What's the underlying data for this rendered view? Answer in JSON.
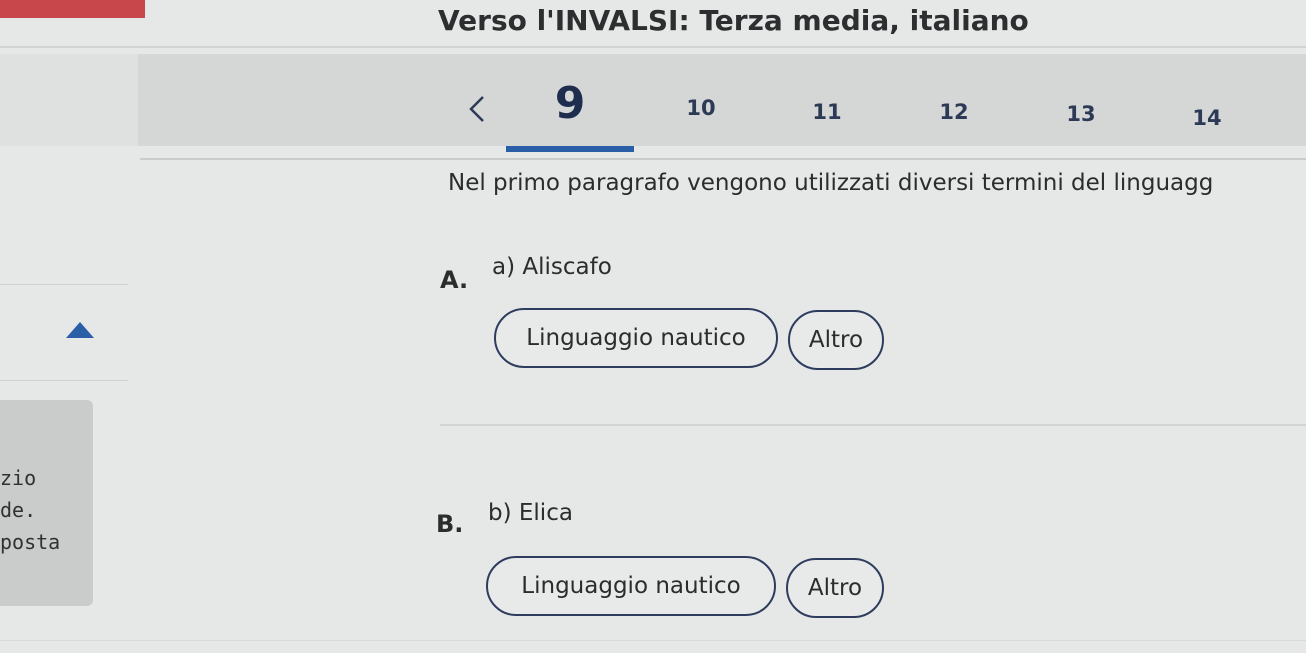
{
  "header": {
    "title": "Verso l'INVALSI: Terza media, italiano",
    "accent_color": "#c8474a"
  },
  "question_nav": {
    "prev_icon": "chevron-left-icon",
    "current": "9",
    "numbers": [
      "9",
      "10",
      "11",
      "12",
      "13",
      "14"
    ],
    "underline_color": "#2a5fa8"
  },
  "sidebar": {
    "arrow_icon": "triangle-up-icon",
    "text_lines": [
      "zio",
      "de.",
      "posta"
    ]
  },
  "question": {
    "prompt": "Nel primo paragrafo vengono utilizzati diversi termini del linguagg"
  },
  "items": [
    {
      "letter": "A.",
      "text": "a) Aliscafo",
      "options": [
        "Linguaggio nautico",
        "Altro"
      ]
    },
    {
      "letter": "B.",
      "text": "b) Elica",
      "options": [
        "Linguaggio nautico",
        "Altro"
      ]
    }
  ]
}
